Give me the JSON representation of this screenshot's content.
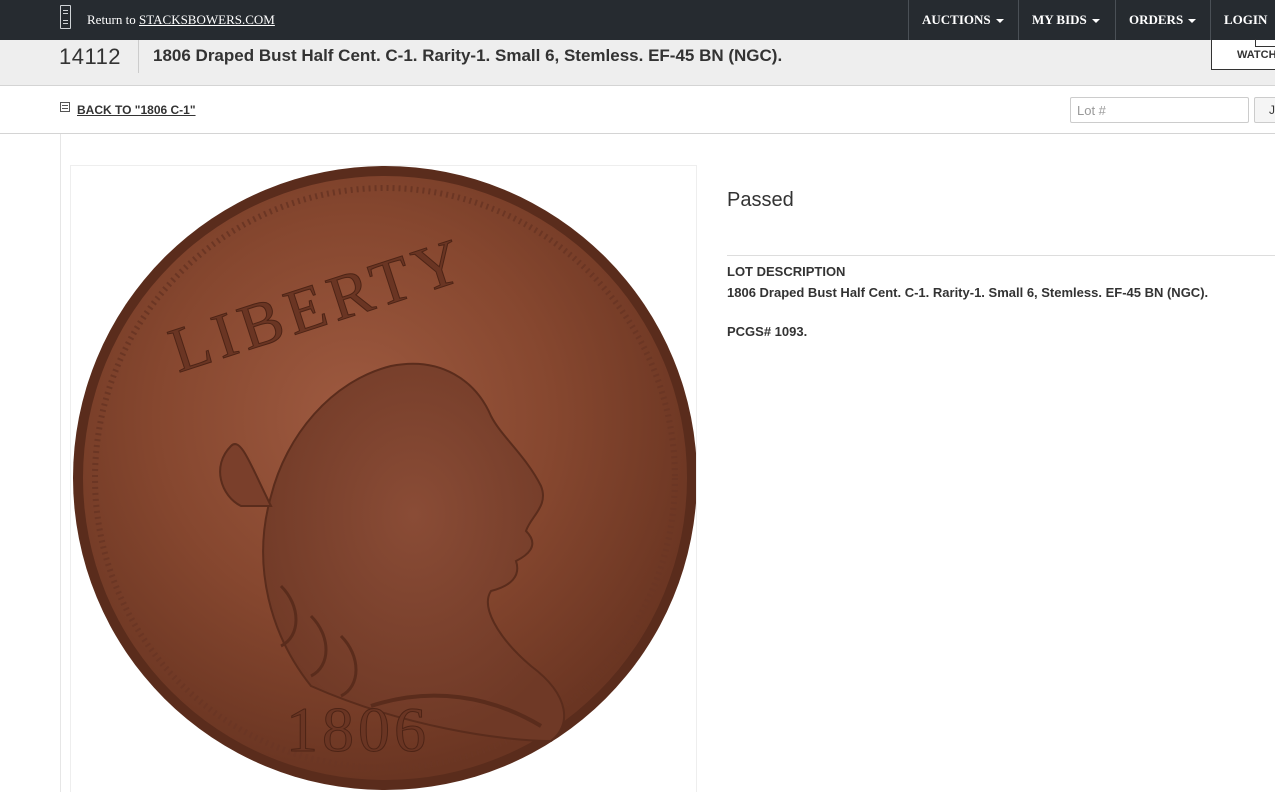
{
  "header": {
    "return_prefix": "Return to",
    "return_link": "STACKSBOWERS.COM",
    "nav": [
      {
        "label": "AUCTIONS",
        "dropdown": true
      },
      {
        "label": "MY BIDS",
        "dropdown": true
      },
      {
        "label": "ORDERS",
        "dropdown": true
      },
      {
        "label": "LOGIN",
        "dropdown": false
      }
    ]
  },
  "lot": {
    "number": "14112",
    "title": "1806 Draped Bust Half Cent. C-1. Rarity-1. Small 6, Stemless. EF-45 BN (NGC).",
    "watch_label": "WATCH"
  },
  "subnav": {
    "back_label": "BACK TO \"1806 C-1\"",
    "lot_search_placeholder": "Lot #",
    "go_label": "J"
  },
  "coin_image": {
    "legend": "LIBERTY",
    "date": "1806"
  },
  "details": {
    "status": "Passed",
    "description_heading": "LOT DESCRIPTION",
    "description": "1806 Draped Bust Half Cent. C-1. Rarity-1. Small 6, Stemless. EF-45 BN (NGC).",
    "pcgs": "PCGS# 1093."
  },
  "colors": {
    "topbar": "#262b30",
    "title_band": "#eeeeee",
    "coin_copper": "#8a4a32"
  }
}
